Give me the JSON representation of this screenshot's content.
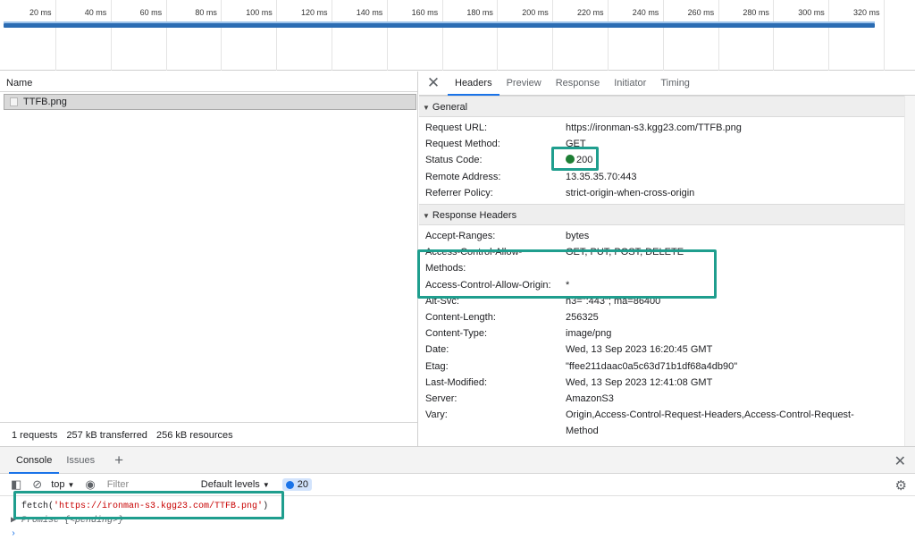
{
  "timeline": {
    "ticks": [
      "20 ms",
      "40 ms",
      "60 ms",
      "80 ms",
      "100 ms",
      "120 ms",
      "140 ms",
      "160 ms",
      "180 ms",
      "200 ms",
      "220 ms",
      "240 ms",
      "260 ms",
      "280 ms",
      "300 ms",
      "320 ms"
    ]
  },
  "name_panel": {
    "header": "Name",
    "file_name": "TTFB.png",
    "summary": {
      "requests": "1 requests",
      "transferred": "257 kB transferred",
      "resources": "256 kB resources"
    }
  },
  "details": {
    "tabs": [
      "Headers",
      "Preview",
      "Response",
      "Initiator",
      "Timing"
    ],
    "active_tab": "Headers",
    "general": {
      "title": "General",
      "rows": [
        {
          "key": "Request URL:",
          "value": "https://ironman-s3.kgg23.com/TTFB.png"
        },
        {
          "key": "Request Method:",
          "value": "GET"
        },
        {
          "key": "Status Code:",
          "value": "200"
        },
        {
          "key": "Remote Address:",
          "value": "13.35.35.70:443"
        },
        {
          "key": "Referrer Policy:",
          "value": "strict-origin-when-cross-origin"
        }
      ]
    },
    "response_headers": {
      "title": "Response Headers",
      "rows": [
        {
          "key": "Accept-Ranges:",
          "value": "bytes"
        },
        {
          "key": "Access-Control-Allow-Methods:",
          "value": "GET, PUT, POST, DELETE"
        },
        {
          "key": "Access-Control-Allow-Origin:",
          "value": "*"
        },
        {
          "key": "Alt-Svc:",
          "value": "h3=\":443\"; ma=86400"
        },
        {
          "key": "Content-Length:",
          "value": "256325"
        },
        {
          "key": "Content-Type:",
          "value": "image/png"
        },
        {
          "key": "Date:",
          "value": "Wed, 13 Sep 2023 16:20:45 GMT"
        },
        {
          "key": "Etag:",
          "value": "\"ffee211daac0a5c63d71b1df68a4db90\""
        },
        {
          "key": "Last-Modified:",
          "value": "Wed, 13 Sep 2023 12:41:08 GMT"
        },
        {
          "key": "Server:",
          "value": "AmazonS3"
        },
        {
          "key": "Vary:",
          "value": "Origin,Access-Control-Request-Headers,Access-Control-Request-Method"
        }
      ]
    }
  },
  "drawer": {
    "tabs": [
      "Console",
      "Issues"
    ],
    "active_tab": "Console",
    "toolbar": {
      "context": "top",
      "filter_placeholder": "Filter",
      "levels": "Default levels",
      "issues_count": "20"
    },
    "console": {
      "input_prefix": "fetch(",
      "input_string": "'https://ironman-s3.kgg23.com/TTFB.png'",
      "input_suffix": ")",
      "output": "▶ Promise {<pending>}",
      "prompt": "›"
    }
  },
  "colors": {
    "highlight": "#1f9e8e",
    "timeline_bar": "#2b6cb3",
    "status_ok": "#1e7e34",
    "active_tab_underline": "#1a73e8"
  }
}
